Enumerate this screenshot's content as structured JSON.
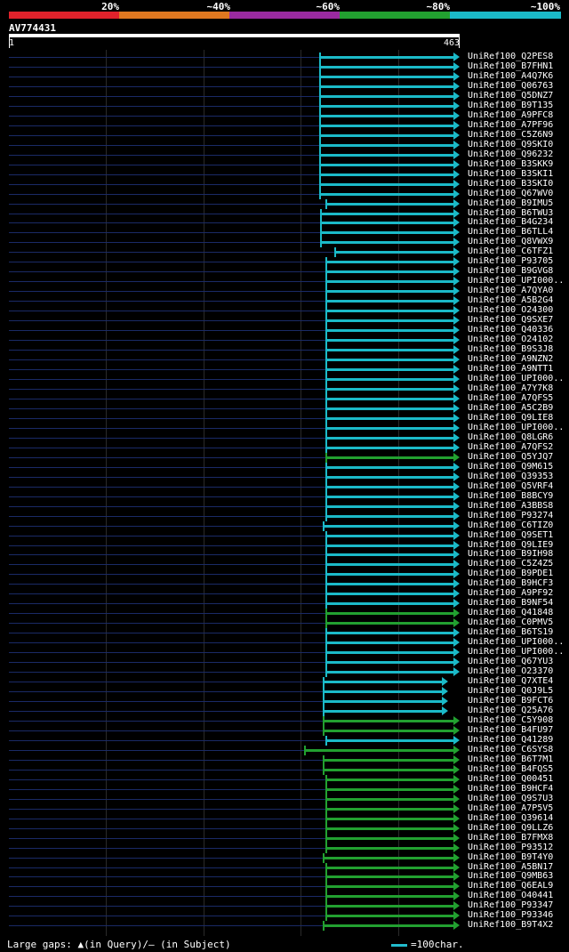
{
  "header": {
    "pct_labels": [
      "20%",
      "~40%",
      "~60%",
      "~80%",
      "~100%"
    ],
    "band_colors": [
      "#e0222b",
      "#e07820",
      "#9a2aa0",
      "#22a030",
      "#1bbac8"
    ],
    "query_name": "AV774431",
    "ruler_start": "1",
    "ruler_end": "463"
  },
  "footer": {
    "gap_text": "Large gaps: ▲(in Query)/– (in Subject)",
    "legend_text": "=100char."
  },
  "colors": {
    "cyan": "#1bbac8",
    "green": "#22a030",
    "baseline": "#1a2a66"
  },
  "chart_data": {
    "type": "alignment",
    "query_length": 463,
    "hits": [
      {
        "name": "UniRef100_Q2PES8",
        "start": 320,
        "end": 463,
        "color": "cyan"
      },
      {
        "name": "UniRef100_B7FHN1",
        "start": 320,
        "end": 463,
        "color": "cyan"
      },
      {
        "name": "UniRef100_A4Q7K6",
        "start": 320,
        "end": 463,
        "color": "cyan"
      },
      {
        "name": "UniRef100_Q06763",
        "start": 320,
        "end": 463,
        "color": "cyan"
      },
      {
        "name": "UniRef100_Q5DNZ7",
        "start": 320,
        "end": 463,
        "color": "cyan"
      },
      {
        "name": "UniRef100_B9T135",
        "start": 320,
        "end": 463,
        "color": "cyan"
      },
      {
        "name": "UniRef100_A9PFC8",
        "start": 320,
        "end": 463,
        "color": "cyan"
      },
      {
        "name": "UniRef100_A7PF96",
        "start": 320,
        "end": 463,
        "color": "cyan"
      },
      {
        "name": "UniRef100_C5Z6N9",
        "start": 320,
        "end": 463,
        "color": "cyan"
      },
      {
        "name": "UniRef100_Q9SKI0",
        "start": 320,
        "end": 463,
        "color": "cyan"
      },
      {
        "name": "UniRef100_Q96232",
        "start": 320,
        "end": 463,
        "color": "cyan"
      },
      {
        "name": "UniRef100_B3SKK9",
        "start": 320,
        "end": 463,
        "color": "cyan"
      },
      {
        "name": "UniRef100_B3SKI1",
        "start": 320,
        "end": 463,
        "color": "cyan"
      },
      {
        "name": "UniRef100_B3SKI0",
        "start": 320,
        "end": 463,
        "color": "cyan"
      },
      {
        "name": "UniRef100_Q67WV0",
        "start": 320,
        "end": 463,
        "color": "cyan"
      },
      {
        "name": "UniRef100_B9IMU5",
        "start": 326,
        "end": 463,
        "color": "cyan"
      },
      {
        "name": "UniRef100_B6TWU3",
        "start": 321,
        "end": 463,
        "color": "cyan"
      },
      {
        "name": "UniRef100_B4G234",
        "start": 321,
        "end": 463,
        "color": "cyan"
      },
      {
        "name": "UniRef100_B6TLL4",
        "start": 321,
        "end": 463,
        "color": "cyan"
      },
      {
        "name": "UniRef100_Q8VWX9",
        "start": 321,
        "end": 463,
        "color": "cyan"
      },
      {
        "name": "UniRef100_C6TFZ1",
        "start": 335,
        "end": 463,
        "color": "cyan"
      },
      {
        "name": "UniRef100_P93705",
        "start": 326,
        "end": 463,
        "color": "cyan"
      },
      {
        "name": "UniRef100_B9GVG8",
        "start": 326,
        "end": 463,
        "color": "cyan"
      },
      {
        "name": "UniRef100_UPI000..",
        "start": 326,
        "end": 463,
        "color": "cyan"
      },
      {
        "name": "UniRef100_A7QYA0",
        "start": 326,
        "end": 463,
        "color": "cyan"
      },
      {
        "name": "UniRef100_A5B2G4",
        "start": 326,
        "end": 463,
        "color": "cyan"
      },
      {
        "name": "UniRef100_O24300",
        "start": 326,
        "end": 463,
        "color": "cyan"
      },
      {
        "name": "UniRef100_Q9SXE7",
        "start": 326,
        "end": 463,
        "color": "cyan"
      },
      {
        "name": "UniRef100_Q40336",
        "start": 326,
        "end": 463,
        "color": "cyan"
      },
      {
        "name": "UniRef100_O24102",
        "start": 326,
        "end": 463,
        "color": "cyan"
      },
      {
        "name": "UniRef100_B9S3J8",
        "start": 326,
        "end": 463,
        "color": "cyan"
      },
      {
        "name": "UniRef100_A9NZN2",
        "start": 326,
        "end": 463,
        "color": "cyan"
      },
      {
        "name": "UniRef100_A9NTT1",
        "start": 326,
        "end": 463,
        "color": "cyan"
      },
      {
        "name": "UniRef100_UPI000..",
        "start": 326,
        "end": 463,
        "color": "cyan"
      },
      {
        "name": "UniRef100_A7Y7K8",
        "start": 326,
        "end": 463,
        "color": "cyan"
      },
      {
        "name": "UniRef100_A7QFS5",
        "start": 326,
        "end": 463,
        "color": "cyan"
      },
      {
        "name": "UniRef100_A5C2B9",
        "start": 326,
        "end": 463,
        "color": "cyan"
      },
      {
        "name": "UniRef100_Q9LIE8",
        "start": 326,
        "end": 463,
        "color": "cyan"
      },
      {
        "name": "UniRef100_UPI000..",
        "start": 326,
        "end": 463,
        "color": "cyan"
      },
      {
        "name": "UniRef100_Q8LGR6",
        "start": 326,
        "end": 463,
        "color": "cyan"
      },
      {
        "name": "UniRef100_A7QFS2",
        "start": 326,
        "end": 463,
        "color": "cyan"
      },
      {
        "name": "UniRef100_Q5YJQ7",
        "start": 326,
        "end": 463,
        "color": "green"
      },
      {
        "name": "UniRef100_Q9M615",
        "start": 326,
        "end": 463,
        "color": "cyan"
      },
      {
        "name": "UniRef100_Q39353",
        "start": 326,
        "end": 463,
        "color": "cyan"
      },
      {
        "name": "UniRef100_Q5VRF4",
        "start": 326,
        "end": 463,
        "color": "cyan"
      },
      {
        "name": "UniRef100_B8BCY9",
        "start": 326,
        "end": 463,
        "color": "cyan"
      },
      {
        "name": "UniRef100_A3BBS8",
        "start": 326,
        "end": 463,
        "color": "cyan"
      },
      {
        "name": "UniRef100_P93274",
        "start": 326,
        "end": 463,
        "color": "cyan"
      },
      {
        "name": "UniRef100_C6TIZ0",
        "start": 323,
        "end": 463,
        "color": "cyan"
      },
      {
        "name": "UniRef100_Q9SET1",
        "start": 326,
        "end": 463,
        "color": "cyan"
      },
      {
        "name": "UniRef100_Q9LIE9",
        "start": 326,
        "end": 463,
        "color": "cyan"
      },
      {
        "name": "UniRef100_B9IH98",
        "start": 326,
        "end": 463,
        "color": "cyan"
      },
      {
        "name": "UniRef100_C5Z4Z5",
        "start": 326,
        "end": 463,
        "color": "cyan"
      },
      {
        "name": "UniRef100_B9PDE1",
        "start": 326,
        "end": 463,
        "color": "cyan"
      },
      {
        "name": "UniRef100_B9HCF3",
        "start": 326,
        "end": 463,
        "color": "cyan"
      },
      {
        "name": "UniRef100_A9PF92",
        "start": 326,
        "end": 463,
        "color": "cyan"
      },
      {
        "name": "UniRef100_B9NF54",
        "start": 326,
        "end": 463,
        "color": "cyan"
      },
      {
        "name": "UniRef100_Q41848",
        "start": 326,
        "end": 463,
        "color": "green"
      },
      {
        "name": "UniRef100_C0PMV5",
        "start": 326,
        "end": 463,
        "color": "green"
      },
      {
        "name": "UniRef100_B6TS19",
        "start": 326,
        "end": 463,
        "color": "cyan"
      },
      {
        "name": "UniRef100_UPI000..",
        "start": 326,
        "end": 463,
        "color": "cyan"
      },
      {
        "name": "UniRef100_UPI000..",
        "start": 326,
        "end": 463,
        "color": "cyan"
      },
      {
        "name": "UniRef100_Q67YU3",
        "start": 326,
        "end": 463,
        "color": "cyan"
      },
      {
        "name": "UniRef100_O23370",
        "start": 326,
        "end": 463,
        "color": "cyan"
      },
      {
        "name": "UniRef100_Q7XTE4",
        "start": 323,
        "end": 451,
        "color": "cyan"
      },
      {
        "name": "UniRef100_Q0J9L5",
        "start": 323,
        "end": 451,
        "color": "cyan"
      },
      {
        "name": "UniRef100_B9FCT6",
        "start": 323,
        "end": 451,
        "color": "cyan"
      },
      {
        "name": "UniRef100_Q25A76",
        "start": 323,
        "end": 451,
        "color": "cyan"
      },
      {
        "name": "UniRef100_C5Y908",
        "start": 323,
        "end": 463,
        "color": "green"
      },
      {
        "name": "UniRef100_B4FU97",
        "start": 323,
        "end": 463,
        "color": "green"
      },
      {
        "name": "UniRef100_Q41289",
        "start": 326,
        "end": 463,
        "color": "cyan"
      },
      {
        "name": "UniRef100_C6SYS8",
        "start": 304,
        "end": 463,
        "color": "green"
      },
      {
        "name": "UniRef100_B6T7M1",
        "start": 323,
        "end": 463,
        "color": "green"
      },
      {
        "name": "UniRef100_B4FQS5",
        "start": 323,
        "end": 463,
        "color": "green"
      },
      {
        "name": "UniRef100_Q00451",
        "start": 326,
        "end": 463,
        "color": "green"
      },
      {
        "name": "UniRef100_B9HCF4",
        "start": 326,
        "end": 463,
        "color": "green"
      },
      {
        "name": "UniRef100_Q9S7U3",
        "start": 326,
        "end": 463,
        "color": "green"
      },
      {
        "name": "UniRef100_A7P5V5",
        "start": 326,
        "end": 463,
        "color": "green"
      },
      {
        "name": "UniRef100_Q39614",
        "start": 326,
        "end": 463,
        "color": "green"
      },
      {
        "name": "UniRef100_Q9LLZ6",
        "start": 326,
        "end": 463,
        "color": "green"
      },
      {
        "name": "UniRef100_B7FMX8",
        "start": 326,
        "end": 463,
        "color": "green"
      },
      {
        "name": "UniRef100_P93512",
        "start": 326,
        "end": 463,
        "color": "green"
      },
      {
        "name": "UniRef100_B9T4Y0",
        "start": 323,
        "end": 463,
        "color": "green"
      },
      {
        "name": "UniRef100_A5BN17",
        "start": 326,
        "end": 463,
        "color": "green"
      },
      {
        "name": "UniRef100_Q9MB63",
        "start": 326,
        "end": 463,
        "color": "green"
      },
      {
        "name": "UniRef100_Q6EAL9",
        "start": 326,
        "end": 463,
        "color": "green"
      },
      {
        "name": "UniRef100_O40441",
        "start": 326,
        "end": 463,
        "color": "green"
      },
      {
        "name": "UniRef100_P93347",
        "start": 326,
        "end": 463,
        "color": "green"
      },
      {
        "name": "UniRef100_P93346",
        "start": 326,
        "end": 463,
        "color": "green"
      },
      {
        "name": "UniRef100_B9T4X2",
        "start": 323,
        "end": 463,
        "color": "green"
      }
    ]
  }
}
